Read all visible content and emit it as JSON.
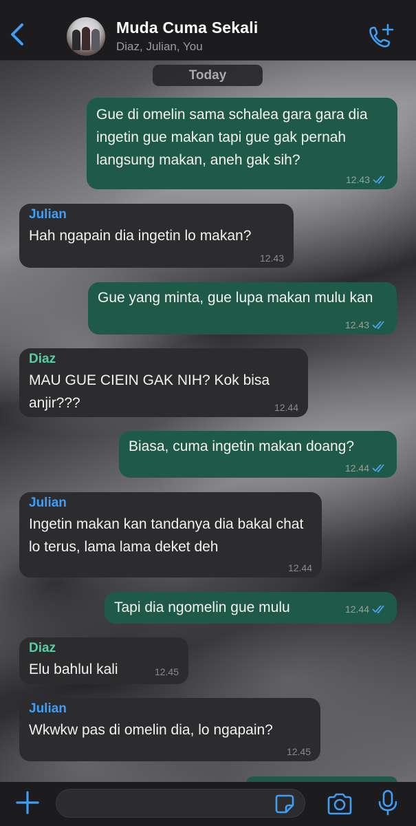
{
  "header": {
    "title": "Muda Cuma Sekali",
    "subtitle": "Diaz, Julian, You",
    "icons": {
      "back": "chevron-left-icon",
      "avatar": "group-avatar",
      "call": "phone-add-icon"
    }
  },
  "date_separator": "Today",
  "messages": [
    {
      "dir": "out",
      "text": "Gue di omelin sama schalea gara gara dia ingetin gue makan tapi gue gak pernah langsung makan, aneh gak sih?",
      "time": "12.43",
      "read": true
    },
    {
      "dir": "in",
      "sender": "Julian",
      "text": "Hah ngapain dia ingetin lo makan?",
      "time": "12.43"
    },
    {
      "dir": "out",
      "text": "Gue yang minta, gue lupa makan mulu kan",
      "time": "12.43",
      "read": true
    },
    {
      "dir": "in",
      "sender": "Diaz",
      "text": "MAU GUE CIEIN GAK NIH? Kok bisa anjir???",
      "time": "12.44"
    },
    {
      "dir": "out",
      "text": "Biasa, cuma ingetin makan doang?",
      "time": "12.44",
      "read": true
    },
    {
      "dir": "in",
      "sender": "Julian",
      "text": "Ingetin makan kan tandanya dia bakal chat lo terus, lama lama deket deh",
      "time": "12.44"
    },
    {
      "dir": "out",
      "text": "Tapi dia ngomelin gue mulu",
      "time": "12.44",
      "read": true
    },
    {
      "dir": "in",
      "sender": "Diaz",
      "text": "Elu bahlul kali",
      "time": "12.45"
    },
    {
      "dir": "in",
      "sender": "Julian",
      "text": "Wkwkw pas di omelin dia, lo ngapain?",
      "time": "12.45"
    }
  ],
  "composer": {
    "input_value": "",
    "icons": {
      "plus": "plus-icon",
      "sticker": "sticker-icon",
      "camera": "camera-icon",
      "mic": "microphone-icon"
    }
  },
  "colors": {
    "outgoing_bubble": "#1f5a48",
    "incoming_bubble": "#2c2c2e",
    "accent": "#3f9ef5",
    "julian_name": "#3f9ef5",
    "diaz_name": "#4fd1a3"
  }
}
